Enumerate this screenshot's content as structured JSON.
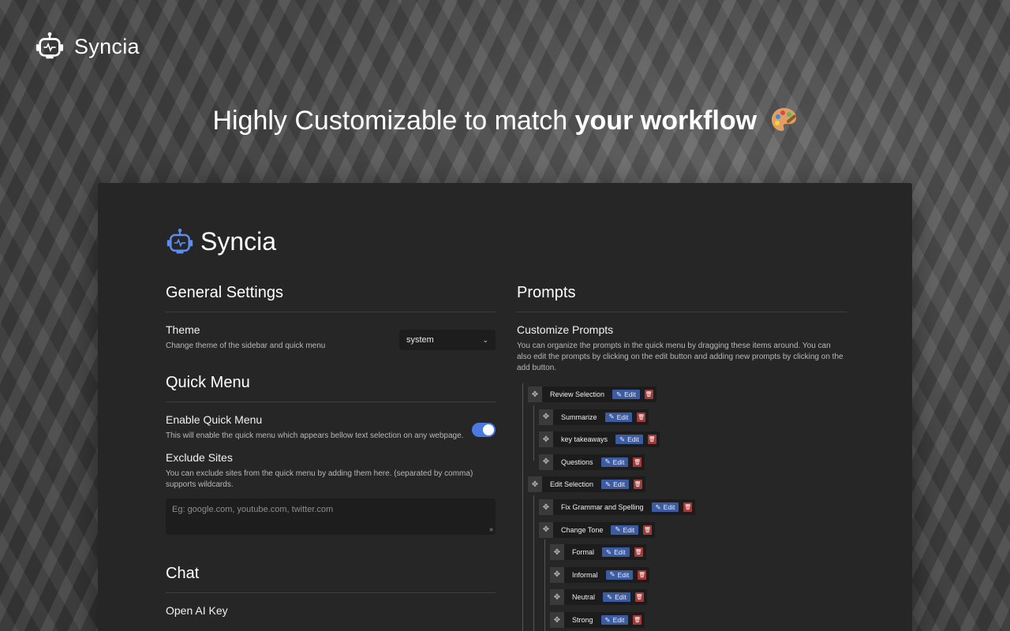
{
  "brand": {
    "name": "Syncia"
  },
  "headline": {
    "normal": "Highly Customizable to match ",
    "bold": "your workflow"
  },
  "panel": {
    "brand": "Syncia",
    "general": {
      "title": "General Settings",
      "theme": {
        "label": "Theme",
        "desc": "Change theme of the sidebar and quick menu",
        "value": "system"
      }
    },
    "quick_menu": {
      "title": "Quick Menu",
      "enable": {
        "label": "Enable Quick Menu",
        "desc": "This will enable the quick menu which appears bellow text selection on any webpage.",
        "enabled": true
      },
      "exclude": {
        "label": "Exclude Sites",
        "desc": "You can exclude sites from the quick menu by adding them here. (separated by comma) supports wildcards.",
        "placeholder": "Eg: google.com, youtube.com, twitter.com"
      }
    },
    "chat": {
      "title": "Chat",
      "openai_label": "Open AI Key"
    },
    "prompts": {
      "title": "Prompts",
      "customize_label": "Customize Prompts",
      "customize_desc": "You can organize the prompts in the quick menu by dragging these items around. You can also edit the prompts by clicking on the edit button and adding new prompts by clicking on the add button.",
      "edit_label": "Edit",
      "items": [
        {
          "label": "Review Selection",
          "level": 0
        },
        {
          "label": "Summarize",
          "level": 1
        },
        {
          "label": "key takeaways",
          "level": 1
        },
        {
          "label": "Questions",
          "level": 1
        },
        {
          "label": "Edit Selection",
          "level": 0
        },
        {
          "label": "Fix Grammar and Spelling",
          "level": 1
        },
        {
          "label": "Change Tone",
          "level": 1
        },
        {
          "label": "Formal",
          "level": 2
        },
        {
          "label": "Informal",
          "level": 2
        },
        {
          "label": "Neutral",
          "level": 2
        },
        {
          "label": "Strong",
          "level": 2
        }
      ]
    }
  },
  "colors": {
    "accent": "#4a7ae0",
    "edit_button": "#3d5ba0",
    "delete_button": "#a23a3a",
    "panel": "#262626"
  }
}
